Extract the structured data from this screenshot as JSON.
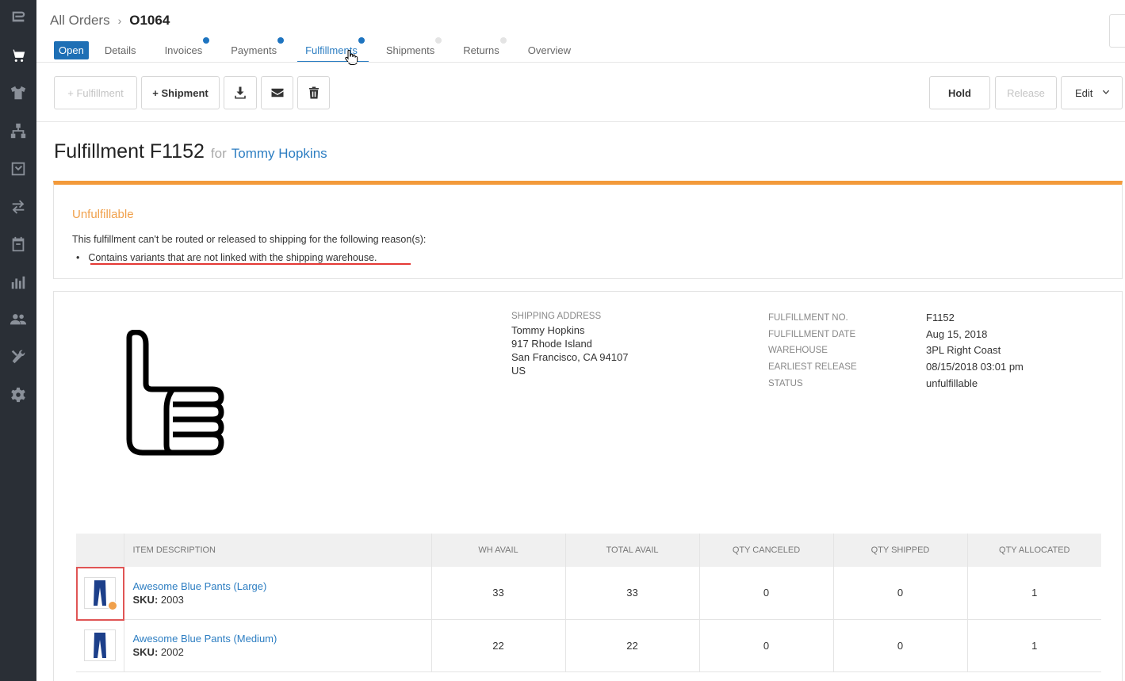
{
  "sidebar": {
    "icons": [
      "logo-icon",
      "cart-icon",
      "shirt-icon",
      "hierarchy-icon",
      "inbox-icon",
      "transfer-icon",
      "calendar-icon",
      "bar-chart-icon",
      "users-icon",
      "tools-icon",
      "gear-icon"
    ]
  },
  "header": {
    "breadcrumb_root": "All Orders",
    "breadcrumb_sep": "›",
    "breadcrumb_current": "O1064",
    "status_badge": "Open",
    "tabs": [
      {
        "label": "Details",
        "dot": ""
      },
      {
        "label": "Invoices",
        "dot": "blue"
      },
      {
        "label": "Payments",
        "dot": "blue"
      },
      {
        "label": "Fulfillments",
        "dot": "blue",
        "active": true
      },
      {
        "label": "Shipments",
        "dot": "gray"
      },
      {
        "label": "Returns",
        "dot": "gray"
      },
      {
        "label": "Overview",
        "dot": ""
      }
    ]
  },
  "toolbar": {
    "add_fulfillment": "+ Fulfillment",
    "add_shipment": "+ Shipment",
    "download_icon": "download-icon",
    "email_icon": "envelope-icon",
    "delete_icon": "trash-icon",
    "hold": "Hold",
    "release": "Release",
    "edit": "Edit"
  },
  "title": {
    "main": "Fulfillment F1152",
    "for": "for",
    "customer": "Tommy Hopkins"
  },
  "alert": {
    "title": "Unfulfillable",
    "text": "This fulfillment can't be routed or released to shipping for the following reason(s):",
    "reasons": [
      "Contains variants that are not linked with the shipping warehouse."
    ],
    "accent_color": "#f39a3a"
  },
  "shipping": {
    "label": "SHIPPING ADDRESS",
    "name": "Tommy  Hopkins",
    "line1": "917 Rhode Island",
    "line2": "San Francisco, CA 94107",
    "country": "US"
  },
  "meta": {
    "labels": [
      "FULFILLMENT NO.",
      "FULFILLMENT DATE",
      "WAREHOUSE",
      "EARLIEST RELEASE",
      "STATUS"
    ],
    "values": [
      "F1152",
      "Aug 15, 2018",
      "3PL Right Coast",
      "08/15/2018 03:01 pm",
      "unfulfillable"
    ]
  },
  "table": {
    "headers": [
      "ITEM DESCRIPTION",
      "WH AVAIL",
      "TOTAL AVAIL",
      "QTY CANCELED",
      "QTY SHIPPED",
      "QTY ALLOCATED"
    ],
    "rows": [
      {
        "name": "Awesome Blue Pants (Large)",
        "sku_label": "SKU:",
        "sku": "2003",
        "wh_avail": "33",
        "total_avail": "33",
        "qty_canceled": "0",
        "qty_shipped": "0",
        "qty_allocated": "1"
      },
      {
        "name": "Awesome Blue Pants (Medium)",
        "sku_label": "SKU:",
        "sku": "2002",
        "wh_avail": "22",
        "total_avail": "22",
        "qty_canceled": "0",
        "qty_shipped": "0",
        "qty_allocated": "1"
      }
    ]
  },
  "colors": {
    "sidebar": "#2a2f36",
    "accent_blue": "#2d7ec2",
    "badge_blue": "#1e6fb5",
    "warning_orange": "#f0a04b",
    "highlight_red": "#e05555"
  }
}
